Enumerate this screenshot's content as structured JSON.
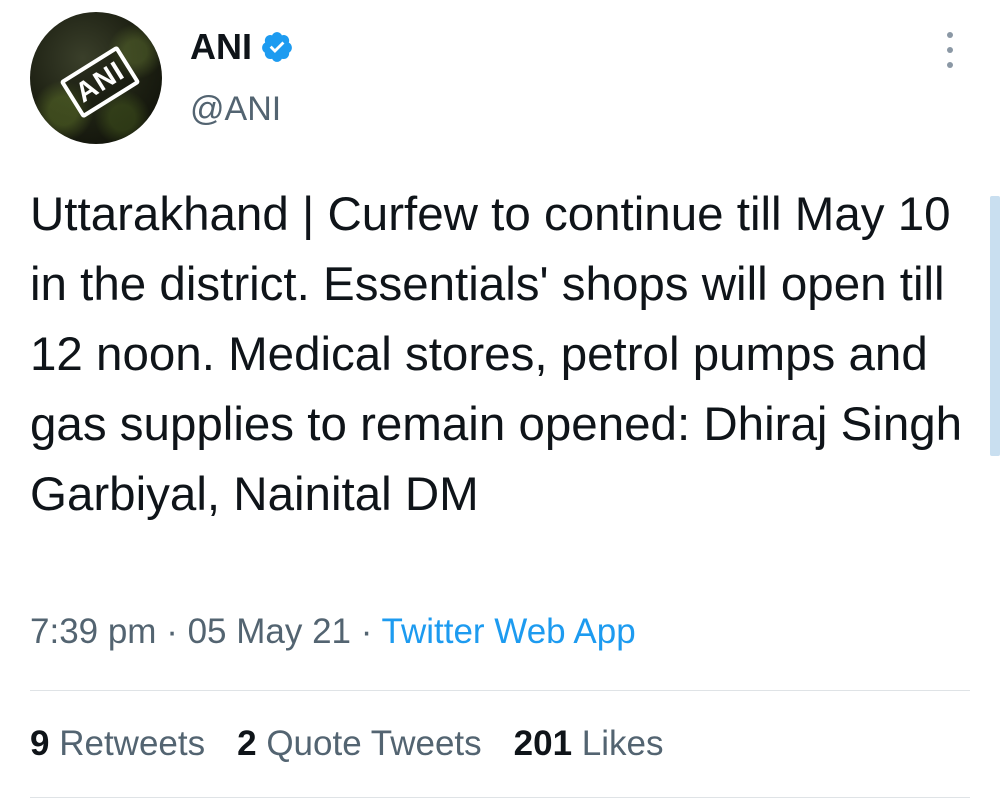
{
  "author": {
    "display_name": "ANI",
    "handle": "@ANI",
    "avatar_text": "ANI",
    "verified": true
  },
  "tweet": {
    "text": "Uttarakhand | Curfew to continue till May 10 in the district. Essentials' shops will open till 12 noon. Medical stores, petrol pumps and gas supplies to remain opened: Dhiraj Singh Garbiyal, Nainital DM",
    "time": "7:39 pm",
    "date": "05 May 21",
    "separator": "·",
    "source": "Twitter Web App"
  },
  "stats": {
    "retweets_count": "9",
    "retweets_label": "Retweets",
    "quotes_count": "2",
    "quotes_label": "Quote Tweets",
    "likes_count": "201",
    "likes_label": "Likes"
  },
  "icons": {
    "verified": "verified-badge-icon",
    "more": "more-vertical-icon"
  },
  "colors": {
    "accent": "#1d9bf0",
    "text": "#0f1419",
    "secondary": "#536471"
  }
}
